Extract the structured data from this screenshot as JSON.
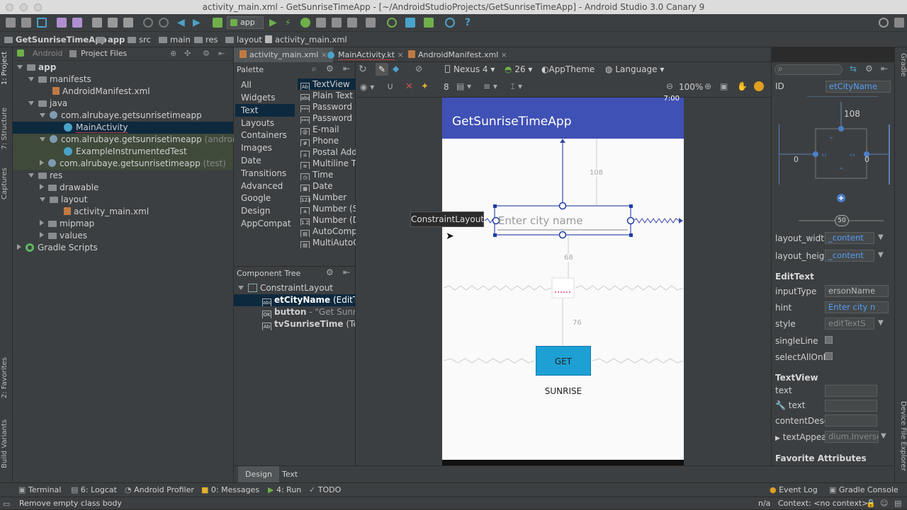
{
  "window": {
    "title": "activity_main.xml - GetSunriseTimeApp - [~/AndroidStudioProjects/GetSunriseTimeApp] - Android Studio 3.0 Canary 9"
  },
  "toolbar": {
    "run_config": "app"
  },
  "breadcrumb": [
    "GetSunriseTimeApp",
    "app",
    "src",
    "main",
    "res",
    "layout",
    "activity_main.xml"
  ],
  "project_panel": {
    "tabs": [
      "Android",
      "Project Files"
    ],
    "tree": [
      {
        "label": "app",
        "level": 0
      },
      {
        "label": "manifests",
        "level": 1
      },
      {
        "label": "AndroidManifest.xml",
        "level": 2
      },
      {
        "label": "java",
        "level": 1
      },
      {
        "label": "com.alrubaye.getsunrisetimeapp",
        "level": 2
      },
      {
        "label": "MainActivity",
        "level": 3
      },
      {
        "label": "com.alrubaye.getsunrisetimeapp",
        "suffix": "(androidTe",
        "level": 2
      },
      {
        "label": "ExampleInstrumentedTest",
        "level": 3
      },
      {
        "label": "com.alrubaye.getsunrisetimeapp",
        "suffix": "(test)",
        "level": 2
      },
      {
        "label": "res",
        "level": 1
      },
      {
        "label": "drawable",
        "level": 2
      },
      {
        "label": "layout",
        "level": 2
      },
      {
        "label": "activity_main.xml",
        "level": 3
      },
      {
        "label": "mipmap",
        "level": 2
      },
      {
        "label": "values",
        "level": 2
      },
      {
        "label": "Gradle Scripts",
        "level": 0
      }
    ]
  },
  "left_strip": {
    "project": "1: Project",
    "structure": "7: Structure",
    "captures": "Captures",
    "favorites": "2: Favorites",
    "build_variants": "Build Variants"
  },
  "editor_tabs": [
    "activity_main.xml",
    "MainActivity.kt",
    "AndroidManifest.xml"
  ],
  "palette": {
    "title": "Palette",
    "categories": [
      "All",
      "Widgets",
      "Text",
      "Layouts",
      "Containers",
      "Images",
      "Date",
      "Transitions",
      "Advanced",
      "Google",
      "Design",
      "AppCompat"
    ],
    "items": [
      {
        "icon": "Ab",
        "label": "TextView"
      },
      {
        "icon": "abc",
        "label": "Plain Text"
      },
      {
        "icon": "***",
        "label": "Password"
      },
      {
        "icon": "***",
        "label": "Password (N"
      },
      {
        "icon": "@",
        "label": "E-mail"
      },
      {
        "icon": "#",
        "label": "Phone"
      },
      {
        "icon": "⌂",
        "label": "Postal Addr"
      },
      {
        "icon": "≡",
        "label": "Multiline Te"
      },
      {
        "icon": "◷",
        "label": "Time"
      },
      {
        "icon": "▦",
        "label": "Date"
      },
      {
        "icon": "123",
        "label": "Number"
      },
      {
        "icon": "±",
        "label": "Number (Si"
      },
      {
        "icon": "1.2",
        "label": "Number (De"
      },
      {
        "icon": "▤",
        "label": "AutoComple"
      },
      {
        "icon": "▤",
        "label": "MultiAutoCo"
      }
    ]
  },
  "component_tree": {
    "title": "Component Tree",
    "root": "ConstraintLayout",
    "children": [
      {
        "icon": "abc",
        "name": "etCityName",
        "detail": "(EditTex"
      },
      {
        "icon": "OK",
        "name": "button",
        "detail": "- \"Get Sunris"
      },
      {
        "icon": "Ab",
        "name": "tvSunriseTime",
        "detail": "(Text"
      }
    ]
  },
  "design_toolbar": {
    "device": "Nexus 4",
    "api": "26",
    "theme": "AppTheme",
    "language": "Language",
    "margin": "8",
    "zoom": "100%"
  },
  "preview": {
    "status_time": "7:00",
    "app_title": "GetSunriseTimeApp",
    "edittext_hint": "Enter city name",
    "button_label": "GET SUNRISE",
    "tooltip": "ConstraintLayout",
    "margin_top": "108",
    "margin_mid": "68",
    "margin_btn": "76"
  },
  "attributes": {
    "id_label": "ID",
    "id_value": "etCityName",
    "inspector_top": "108",
    "inspector_left": "0",
    "inspector_right": "0",
    "bias": "50",
    "rows": [
      {
        "label": "layout_width",
        "value": "_content"
      },
      {
        "label": "layout_heigh",
        "value": "_content"
      }
    ],
    "edittext_head": "EditText",
    "edittext_rows": [
      {
        "label": "inputType",
        "value": "ersonName"
      },
      {
        "label": "hint",
        "value": "Enter city n"
      },
      {
        "label": "style",
        "value": "editTextS"
      },
      {
        "label": "singleLine",
        "value": ""
      },
      {
        "label": "selectAllOnF",
        "value": ""
      }
    ],
    "textview_head": "TextView",
    "textview_rows": [
      {
        "label": "text",
        "value": ""
      },
      {
        "label": "text",
        "value": ""
      },
      {
        "label": "contentDesc",
        "value": ""
      },
      {
        "label": "textAppea",
        "value": "dium.Inverse"
      }
    ],
    "favorites_head": "Favorite Attributes"
  },
  "right_strip": {
    "gradle": "Gradle",
    "device_explorer": "Device File Explorer"
  },
  "bottom_tabs": [
    "Design",
    "Text"
  ],
  "tool_windows": [
    "Terminal",
    "6: Logcat",
    "Android Profiler",
    "0: Messages",
    "4: Run",
    "TODO"
  ],
  "tool_windows_right": [
    "Event Log",
    "Gradle Console"
  ],
  "status": {
    "message": "Remove empty class body",
    "position": "n/a",
    "context": "Context: <no context>"
  }
}
